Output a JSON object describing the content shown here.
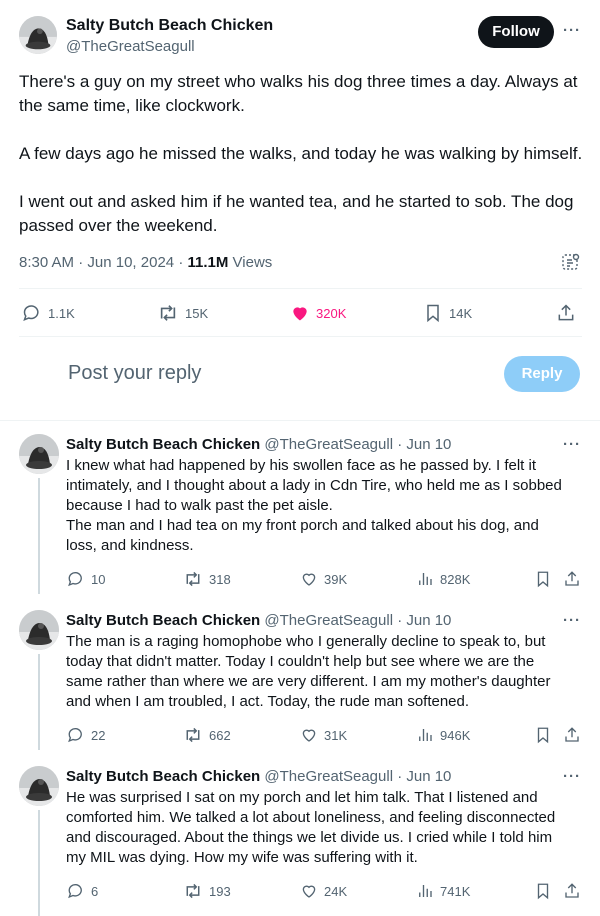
{
  "main_tweet": {
    "author_name": "Salty Butch Beach Chicken",
    "handle": "@TheGreatSeagull",
    "follow_label": "Follow",
    "paragraphs": [
      "There's a guy on my street who walks his dog three times a day. Always at the same time, like clockwork.",
      "A few days ago he missed the walks, and today he was walking by himself.",
      "I went out and asked him if he wanted tea, and he started to sob. The dog passed over the weekend."
    ],
    "time": "8:30 AM",
    "date": "Jun 10, 2024",
    "views_count": "11.1M",
    "views_label": "Views",
    "stats": {
      "replies": "1.1K",
      "reposts": "15K",
      "likes": "320K",
      "bookmarks": "14K"
    }
  },
  "composer": {
    "placeholder": "Post your reply",
    "reply_label": "Reply"
  },
  "replies": [
    {
      "author_name": "Salty Butch Beach Chicken",
      "meta": "@TheGreatSeagull · Jun 10",
      "lines": [
        "I knew what had happened by his swollen face as he passed by. I felt it",
        "intimately, and I thought about a lady in Cdn Tire, who held me as I sobbed",
        "because I had to walk past the pet aisle.",
        "The man and I had tea on my front porch and talked about his dog, and",
        "loss, and kindness."
      ],
      "replies": "10",
      "reposts": "318",
      "likes": "39K",
      "views": "828K"
    },
    {
      "author_name": "Salty Butch Beach Chicken",
      "meta": "@TheGreatSeagull · Jun 10",
      "lines": [
        "The man is a raging homophobe who I generally decline to speak to, but",
        "today that didn't matter. Today I couldn't help but see where we are the",
        "same rather than where we are very different. I am my mother's daughter",
        "and when I am troubled, I act. Today, the rude man softened."
      ],
      "replies": "22",
      "reposts": "662",
      "likes": "31K",
      "views": "946K"
    },
    {
      "author_name": "Salty Butch Beach Chicken",
      "meta": "@TheGreatSeagull · Jun 10",
      "lines": [
        "He was surprised I sat on my porch and let him talk. That I listened and",
        "comforted him.  We talked a lot about loneliness, and feeling disconnected",
        "and discouraged. About the things we let divide us. I cried while I told him",
        "my MIL was dying. How my wife was suffering with it."
      ],
      "replies": "6",
      "reposts": "193",
      "likes": "24K",
      "views": "741K"
    }
  ],
  "colors": {
    "text": "#0f1419",
    "secondary": "#536471",
    "like_active": "#f91880",
    "reply_button_disabled": "#8ecdf8",
    "follow_button": "#0f1419"
  },
  "icons": [
    "reply-icon",
    "repost-icon",
    "heart-icon",
    "bookmark-icon",
    "share-icon",
    "views-icon",
    "grok-icon",
    "more-icon"
  ]
}
